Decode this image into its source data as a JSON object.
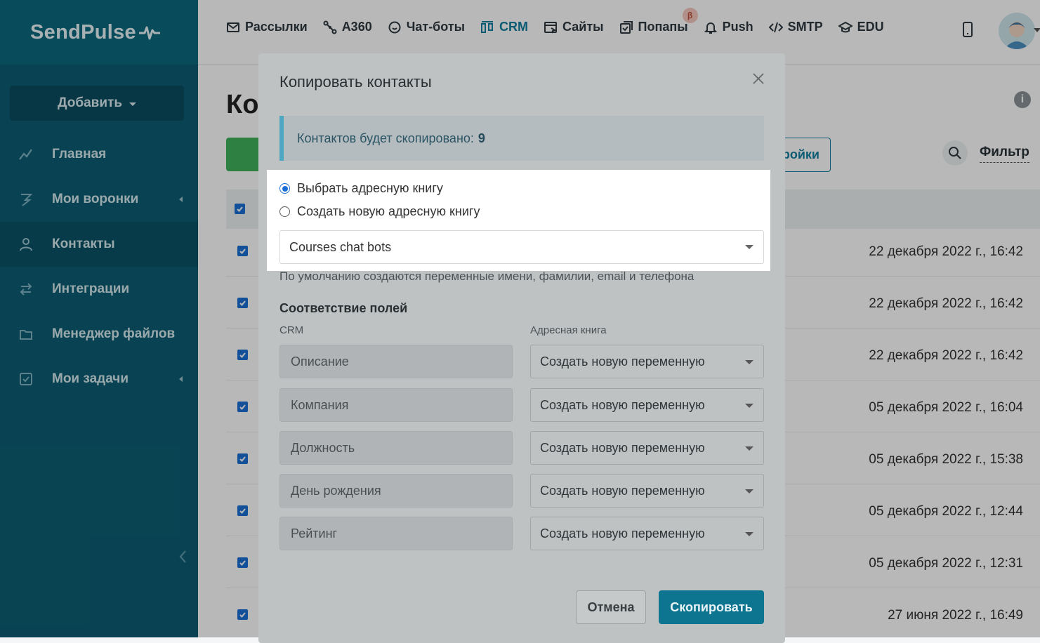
{
  "brand": {
    "logo_text": "SendPulse"
  },
  "sidebar": {
    "add_button": "Добавить",
    "items": [
      {
        "label": "Главная",
        "icon": "chart-line-icon"
      },
      {
        "label": "Мои воронки",
        "icon": "funnel-icon"
      },
      {
        "label": "Контакты",
        "icon": "contacts-icon",
        "active": true
      },
      {
        "label": "Интеграции",
        "icon": "arrows-swap-icon"
      },
      {
        "label": "Менеджер файлов",
        "icon": "folder-icon"
      },
      {
        "label": "Мои задачи",
        "icon": "checkbox-icon"
      }
    ]
  },
  "topnav": {
    "items": [
      {
        "label": "Рассылки",
        "icon": "mail-icon"
      },
      {
        "label": "А360",
        "icon": "nodes-icon"
      },
      {
        "label": "Чат-боты",
        "icon": "chat-icon"
      },
      {
        "label": "CRM",
        "icon": "crm-icon",
        "active": true
      },
      {
        "label": "Сайты",
        "icon": "site-icon"
      },
      {
        "label": "Попапы",
        "icon": "popup-icon"
      },
      {
        "label": "Push",
        "icon": "bell-icon"
      },
      {
        "label": "SMTP",
        "icon": "code-icon"
      },
      {
        "label": "EDU",
        "icon": "graduation-cap-icon"
      }
    ],
    "beta_badge": "β"
  },
  "page": {
    "title_partial": "Ко",
    "settings_button_partial": "ройки",
    "filter_label": "Фильтр",
    "info_icon": "i"
  },
  "table": {
    "rows": [
      {
        "date": "22 декабря 2022 г., 16:42"
      },
      {
        "date": "22 декабря 2022 г., 16:42"
      },
      {
        "date": "22 декабря 2022 г., 16:42"
      },
      {
        "date": "05 декабря 2022 г., 16:04"
      },
      {
        "date": "05 декабря 2022 г., 15:38"
      },
      {
        "date": "05 декабря 2022 г., 12:44"
      },
      {
        "date": "05 декабря 2022 г., 12:31"
      },
      {
        "date": "27 июня 2022 г., 16:49"
      }
    ]
  },
  "modal": {
    "title": "Копировать контакты",
    "info_text": "Контактов будет скопировано:",
    "info_count": "9",
    "radio_select_book": "Выбрать адресную книгу",
    "radio_new_book": "Создать новую адресную книгу",
    "selected_book": "Courses chat bots",
    "hint": "По умолчанию создаются переменные имени, фамилии, email и телефона",
    "mapping_title": "Соответствие полей",
    "col_crm": "CRM",
    "col_book": "Адресная книга",
    "mappings": [
      {
        "crm": "Описание",
        "book": "Создать новую переменную"
      },
      {
        "crm": "Компания",
        "book": "Создать новую переменную"
      },
      {
        "crm": "Должность",
        "book": "Создать новую переменную"
      },
      {
        "crm": "День рождения",
        "book": "Создать новую переменную"
      },
      {
        "crm": "Рейтинг",
        "book": "Создать новую переменную"
      }
    ],
    "cancel": "Отмена",
    "submit": "Скопировать"
  }
}
